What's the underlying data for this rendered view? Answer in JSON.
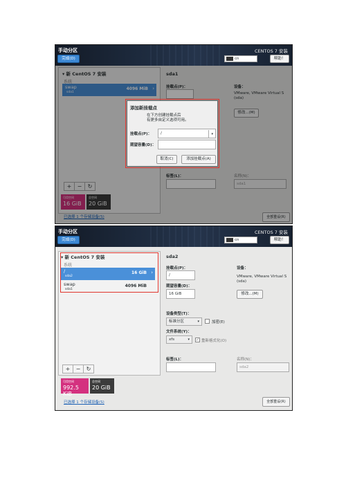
{
  "screen1": {
    "title": "手动分区",
    "done_button": "完成(D)",
    "install_title": "CENTOS 7 安装",
    "keyboard": "cn",
    "help_button": "帮助！",
    "group_title": "▾ 新 CentOS 7 安装",
    "system_label": "系统",
    "partition": {
      "name": "swap",
      "device": "sda1",
      "size": "4096 MiB"
    },
    "device_title": "sda1",
    "mount_point_label": "挂载点(P)：",
    "device_label": "设备：",
    "device_desc": "VMware, VMware Virtual S (sda)",
    "modify_button": "修改...(M)",
    "tag_label": "标签(L)：",
    "name_label": "名称(N)：",
    "name_value": "sda1",
    "add_button": "+",
    "remove_button": "−",
    "refresh_button": "↻",
    "available_label": "可用空间",
    "available_value": "16 GiB",
    "total_label": "总空间",
    "total_value": "20 GiB",
    "storage_link": "已选择 1 个存储设备(S)",
    "reset_button": "全部重设(R)",
    "dialog": {
      "title": "添加新挂载点",
      "desc_line1": "在下方创建挂载点后",
      "desc_line2": "有更多自定义选项可用。",
      "mount_label": "挂载点(P)：",
      "mount_value": "/",
      "capacity_label": "期望容量(D)：",
      "capacity_value": "",
      "cancel_button": "取消(C)",
      "add_button": "添加挂载点(A)"
    }
  },
  "screen2": {
    "title": "手动分区",
    "done_button": "完成(D)",
    "install_title": "CENTOS 7 安装",
    "keyboard": "cn",
    "help_button": "帮助！",
    "group_title": "▾ 新 CentOS 7 安装",
    "system_label": "系统",
    "partitions": [
      {
        "name": "/",
        "device": "sda2",
        "size": "16 GiB",
        "selected": true
      },
      {
        "name": "swap",
        "device": "sda1",
        "size": "4096 MiB",
        "selected": false
      }
    ],
    "device_title": "sda2",
    "mount_point_label": "挂载点(P)：",
    "mount_point_value": "/",
    "capacity_label": "期望容量(D)：",
    "capacity_value": "16 GiB",
    "device_label": "设备：",
    "device_desc": "VMware, VMware Virtual S (sda)",
    "modify_button": "修改...(M)",
    "device_type_label": "设备类型(T)：",
    "device_type_value": "标准分区",
    "encrypt_label": "加密(E)",
    "filesystem_label": "文件系统(Y)：",
    "filesystem_value": "xfs",
    "reformat_label": "重新格式化(O)",
    "tag_label": "标签(L)：",
    "name_label": "名称(N)：",
    "name_value": "sda2",
    "add_button": "+",
    "remove_button": "−",
    "refresh_button": "↻",
    "available_label": "可用空间",
    "available_value": "992.5 KiB",
    "total_label": "总空间",
    "total_value": "20 GiB",
    "storage_link": "已选择 1 个存储设备(S)",
    "reset_button": "全部重设(R)"
  },
  "icons": {
    "chevron_right": "›",
    "dropdown": "▾",
    "check": "✓"
  },
  "colors": {
    "accent": "#4a90d9",
    "available": "#d4317f",
    "highlight": "#e0342c",
    "header": "#1d2a3d"
  }
}
